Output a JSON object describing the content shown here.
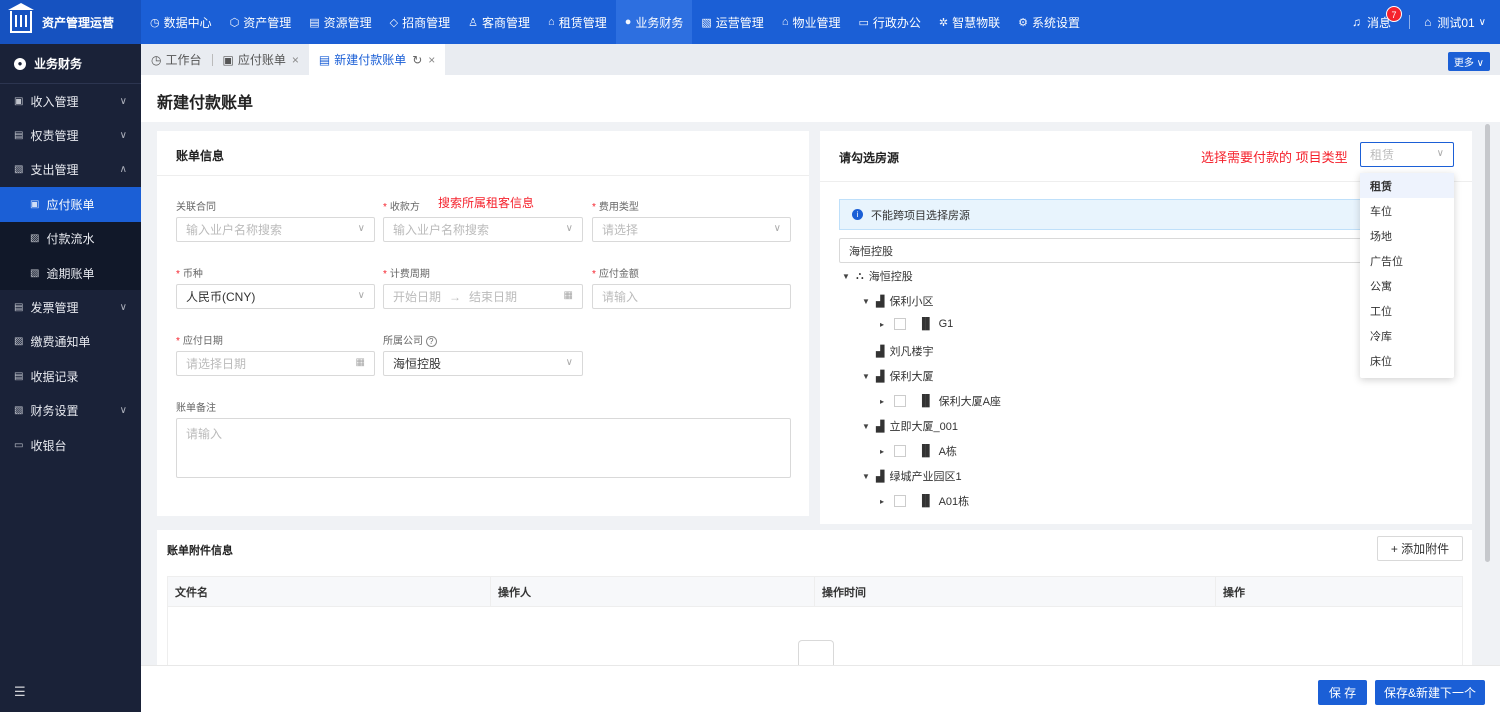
{
  "app": {
    "logo_text": "资产管理运营"
  },
  "topnav": {
    "items": [
      {
        "icon": "◷",
        "label": "数据中心"
      },
      {
        "icon": "⬡",
        "label": "资产管理"
      },
      {
        "icon": "▤",
        "label": "资源管理"
      },
      {
        "icon": "◇",
        "label": "招商管理"
      },
      {
        "icon": "♙",
        "label": "客商管理"
      },
      {
        "icon": "⌂",
        "label": "租赁管理"
      },
      {
        "icon": "●",
        "label": "业务财务"
      },
      {
        "icon": "▧",
        "label": "运营管理"
      },
      {
        "icon": "⌂",
        "label": "物业管理"
      },
      {
        "icon": "▭",
        "label": "行政办公"
      },
      {
        "icon": "✲",
        "label": "智慧物联"
      },
      {
        "icon": "⚙",
        "label": "系统设置"
      }
    ],
    "active_index": 6,
    "message_label": "消息",
    "message_count": "7",
    "user_name": "测试01"
  },
  "sidebar": {
    "header": "业务财务",
    "items": [
      {
        "icon": "▣",
        "label": "收入管理",
        "chev": "∨"
      },
      {
        "icon": "▤",
        "label": "权责管理",
        "chev": "∨"
      },
      {
        "icon": "▧",
        "label": "支出管理",
        "chev": "∧"
      },
      {
        "icon": "▣",
        "label": "应付账单",
        "sub": true,
        "active": true
      },
      {
        "icon": "▨",
        "label": "付款流水",
        "sub": true
      },
      {
        "icon": "▧",
        "label": "逾期账单",
        "sub": true
      },
      {
        "icon": "▤",
        "label": "发票管理",
        "chev": "∨"
      },
      {
        "icon": "▨",
        "label": "缴费通知单"
      },
      {
        "icon": "▤",
        "label": "收据记录"
      },
      {
        "icon": "▧",
        "label": "财务设置",
        "chev": "∨"
      },
      {
        "icon": "▭",
        "label": "收银台"
      }
    ],
    "footer_icon": "☰"
  },
  "tabs": [
    {
      "icon": "◷",
      "label": "工作台"
    },
    {
      "icon": "▣",
      "label": "应付账单",
      "close": "×"
    },
    {
      "icon": "▤",
      "label": "新建付款账单",
      "close": "×",
      "refresh": "↻"
    }
  ],
  "more_label": "更多 ∨",
  "page_title": "新建付款账单",
  "bill_info": {
    "title": "账单信息",
    "fields": {
      "contract": {
        "label": "关联合同",
        "placeholder": "输入业户名称搜索"
      },
      "payee": {
        "label": "收款方",
        "placeholder": "输入业户名称搜索",
        "hint": "搜索所属租客信息"
      },
      "fee_type": {
        "label": "费用类型",
        "placeholder": "请选择"
      },
      "currency": {
        "label": "币种",
        "value": "人民币(CNY)"
      },
      "period": {
        "label": "计费周期",
        "start": "开始日期",
        "arrow": "→",
        "end": "结束日期"
      },
      "amount": {
        "label": "应付金额",
        "placeholder": "请输入"
      },
      "due_date": {
        "label": "应付日期",
        "placeholder": "请选择日期"
      },
      "company": {
        "label": "所属公司",
        "value": "海恒控股"
      },
      "remark": {
        "label": "账单备注",
        "placeholder": "请输入"
      }
    }
  },
  "housing": {
    "title": "请勾选房源",
    "hint": "选择需要付款的 项目类型",
    "type_select_value": "租赁",
    "notice": "不能跨项目选择房源",
    "project_select": "海恒控股",
    "tree": [
      {
        "label": "海恒控股",
        "level": 0,
        "toggle": "▼",
        "icon": "⛬"
      },
      {
        "label": "保利小区",
        "level": 1,
        "toggle": "▼",
        "icon": "▟"
      },
      {
        "label": "G1",
        "level": 2,
        "toggle": "▸",
        "checkbox": true,
        "icon": "▐▌"
      },
      {
        "label": "刘凡楼宇",
        "level": 1,
        "toggle": "",
        "icon": "▟"
      },
      {
        "label": "保利大厦",
        "level": 1,
        "toggle": "▼",
        "icon": "▟"
      },
      {
        "label": "保利大厦A座",
        "level": 2,
        "toggle": "▸",
        "checkbox": true,
        "icon": "▐▌"
      },
      {
        "label": "立即大厦_001",
        "level": 1,
        "toggle": "▼",
        "icon": "▟"
      },
      {
        "label": "A栋",
        "level": 2,
        "toggle": "▸",
        "checkbox": true,
        "icon": "▐▌"
      },
      {
        "label": "绿城产业园区1",
        "level": 1,
        "toggle": "▼",
        "icon": "▟"
      },
      {
        "label": "A01栋",
        "level": 2,
        "toggle": "▸",
        "checkbox": true,
        "icon": "▐▌"
      }
    ],
    "type_options": [
      "租赁",
      "车位",
      "场地",
      "广告位",
      "公寓",
      "工位",
      "冷库",
      "床位"
    ]
  },
  "attachments": {
    "title": "账单附件信息",
    "add_button": "+ 添加附件",
    "columns": [
      "文件名",
      "操作人",
      "操作时间",
      "操作"
    ]
  },
  "footer": {
    "save": "保 存",
    "save_next": "保存&新建下一个"
  },
  "colors": {
    "primary": "#1b5fd6",
    "sidebar": "#1a2238",
    "danger": "#f5222d"
  }
}
